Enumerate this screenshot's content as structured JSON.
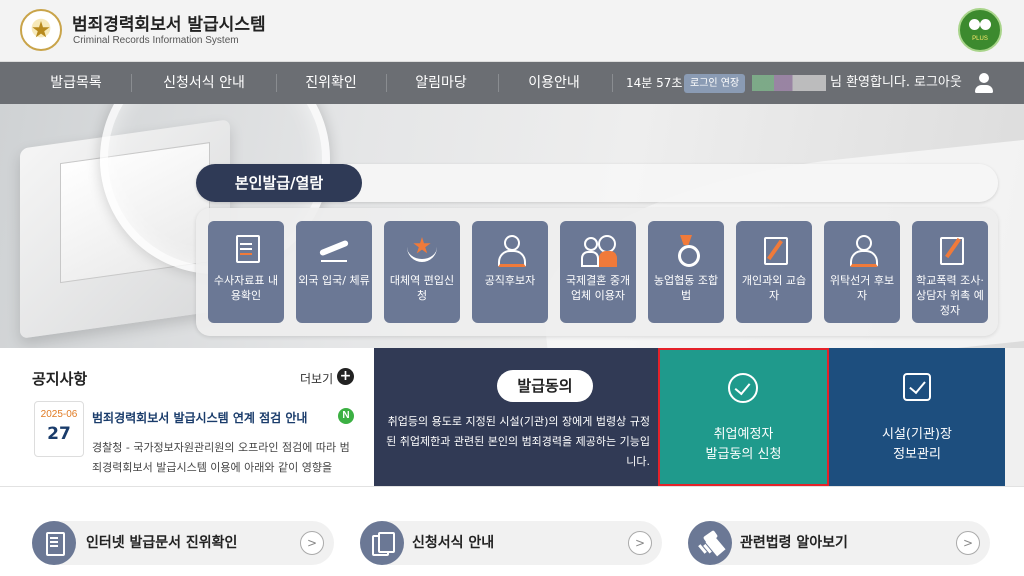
{
  "header": {
    "title": "범죄경력회보서 발급시스템",
    "subtitle": "Criminal Records Information System"
  },
  "nav": {
    "items": [
      "발급목록",
      "신청서식 안내",
      "진위확인",
      "알림마당",
      "이용안내"
    ],
    "timer": "14분 57초",
    "extend_label": "로그인 연장",
    "welcome": "님 환영합니다.",
    "logout_label": "로그아웃"
  },
  "hero": {
    "section_title": "본인발급/열람",
    "services": [
      {
        "label": "수사자료표 내용확인",
        "icon": "id-card-icon"
      },
      {
        "label": "외국 입국/ 체류",
        "icon": "airplane-icon"
      },
      {
        "label": "대체역 편입신청",
        "icon": "military-emblem-icon"
      },
      {
        "label": "공직후보자",
        "icon": "candidate-icon"
      },
      {
        "label": "국제결혼 중개업체 이용자",
        "icon": "couple-icon"
      },
      {
        "label": "농업협동 조합법",
        "icon": "medal-icon"
      },
      {
        "label": "개인과외 교습자",
        "icon": "pen-document-icon"
      },
      {
        "label": "위탁선거 후보자",
        "icon": "person-icon"
      },
      {
        "label": "학교폭력 조사·상담자 위촉 예정자",
        "icon": "document-pen-icon"
      }
    ]
  },
  "notice": {
    "title": "공지사항",
    "more_label": "더보기",
    "date_ym": "2025-06",
    "date_day": "27",
    "headline": "범죄경력회보서 발급시스템 연계 점검 안내",
    "new_badge": "N",
    "body": "경찰청 - 국가정보자원관리원의 오프라인 점검에 따라 범죄경력회보서 발급시스템 이용에 아래와 같이 영향을"
  },
  "consent": {
    "title": "발급동의",
    "description": "취업등의 용도로 지정된 시설(기관)의 장에게 법령상 규정된 취업제한과 관련된 본인의 범죄경력을 제공하는 기능입니다."
  },
  "employment": {
    "line1": "취업예정자",
    "line2": "발급동의 신청"
  },
  "facility": {
    "line1": "시설(기관)장",
    "line2": "정보관리"
  },
  "quick_links": [
    {
      "label": "인터넷 발급문서 진위확인",
      "icon": "certificate-icon"
    },
    {
      "label": "신청서식 안내",
      "icon": "copy-document-icon"
    },
    {
      "label": "관련법령 알아보기",
      "icon": "gavel-icon"
    }
  ],
  "colors": {
    "nav_bg": "#6b6e73",
    "service_tile": "#6b7895",
    "consent_bg": "#313a55",
    "employment_bg": "#1f9a8c",
    "facility_bg": "#1d4e7e",
    "highlight_border": "#e5222a"
  }
}
